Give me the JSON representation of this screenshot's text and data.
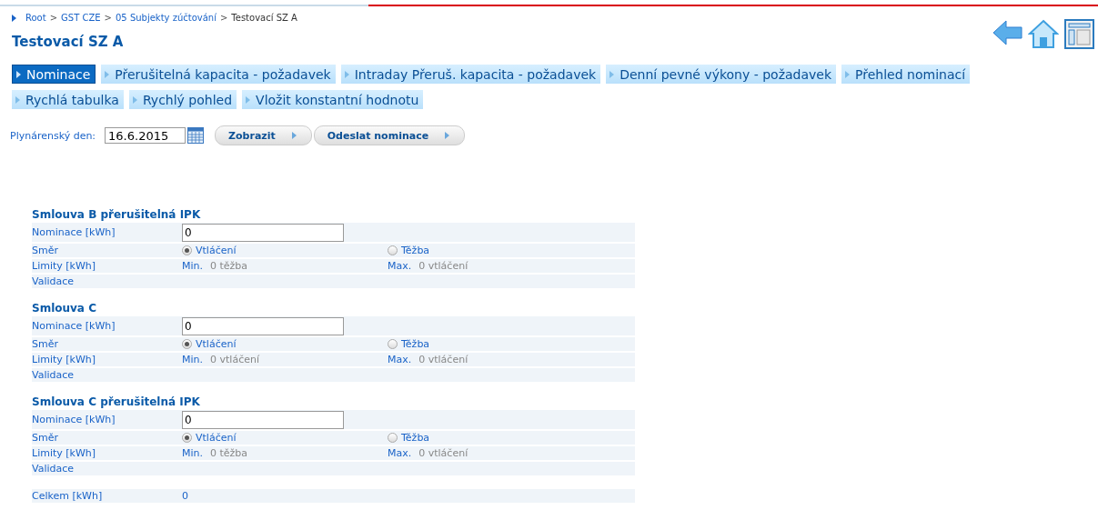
{
  "breadcrumb": [
    {
      "label": "Root",
      "link": true
    },
    {
      "label": "GST CZE",
      "link": true
    },
    {
      "label": "05 Subjekty zúčtování",
      "link": true
    },
    {
      "label": "Testovací SZ A",
      "link": false
    }
  ],
  "breadcrumb_separator": ">",
  "title": "Testovací SZ A",
  "tab_rows": [
    [
      {
        "label": "Nominace",
        "selected": true
      },
      {
        "label": "Přerušitelná kapacita - požadavek",
        "selected": false
      },
      {
        "label": "Intraday Přeruš. kapacita - požadavek",
        "selected": false
      },
      {
        "label": "Denní pevné výkony - požadavek",
        "selected": false
      },
      {
        "label": "Přehled nominací",
        "selected": false
      }
    ],
    [
      {
        "label": "Rychlá tabulka",
        "selected": false
      },
      {
        "label": "Rychlý pohled",
        "selected": false
      },
      {
        "label": "Vložit konstantní hodnotu",
        "selected": false
      }
    ]
  ],
  "gas_day": {
    "label": "Plynárenský den:",
    "value": "16.6.2015"
  },
  "buttons": [
    "Zobrazit",
    "Odeslat nominace"
  ],
  "contracts": [
    {
      "name": "Smlouva B přerušitelná IPK",
      "nomination_label": "Nominace [kWh]",
      "nomination": "0",
      "direction_label": "Směr",
      "options": [
        {
          "label": "Vtláčení",
          "selected": true
        },
        {
          "label": "Těžba",
          "selected": false
        }
      ],
      "limits_label": "Limity [kWh]",
      "min_label": "Min.",
      "min": "0 těžba",
      "max_label": "Max.",
      "max": "0 vtláčení",
      "validation_label": "Validace"
    },
    {
      "name": "Smlouva C",
      "nomination_label": "Nominace [kWh]",
      "nomination": "0",
      "direction_label": "Směr",
      "options": [
        {
          "label": "Vtláčení",
          "selected": true
        },
        {
          "label": "Těžba",
          "selected": false
        }
      ],
      "limits_label": "Limity [kWh]",
      "min_label": "Min.",
      "min": "0 vtláčení",
      "max_label": "Max.",
      "max": "0 vtláčení",
      "validation_label": "Validace"
    },
    {
      "name": "Smlouva C přerušitelná IPK",
      "nomination_label": "Nominace [kWh]",
      "nomination": "0",
      "direction_label": "Směr",
      "options": [
        {
          "label": "Vtláčení",
          "selected": true
        },
        {
          "label": "Těžba",
          "selected": false
        }
      ],
      "limits_label": "Limity [kWh]",
      "min_label": "Min.",
      "min": "0 těžba",
      "max_label": "Max.",
      "max": "0 vtláčení",
      "validation_label": "Validace"
    }
  ],
  "total": {
    "label": "Celkem [kWh]",
    "value": "0"
  }
}
